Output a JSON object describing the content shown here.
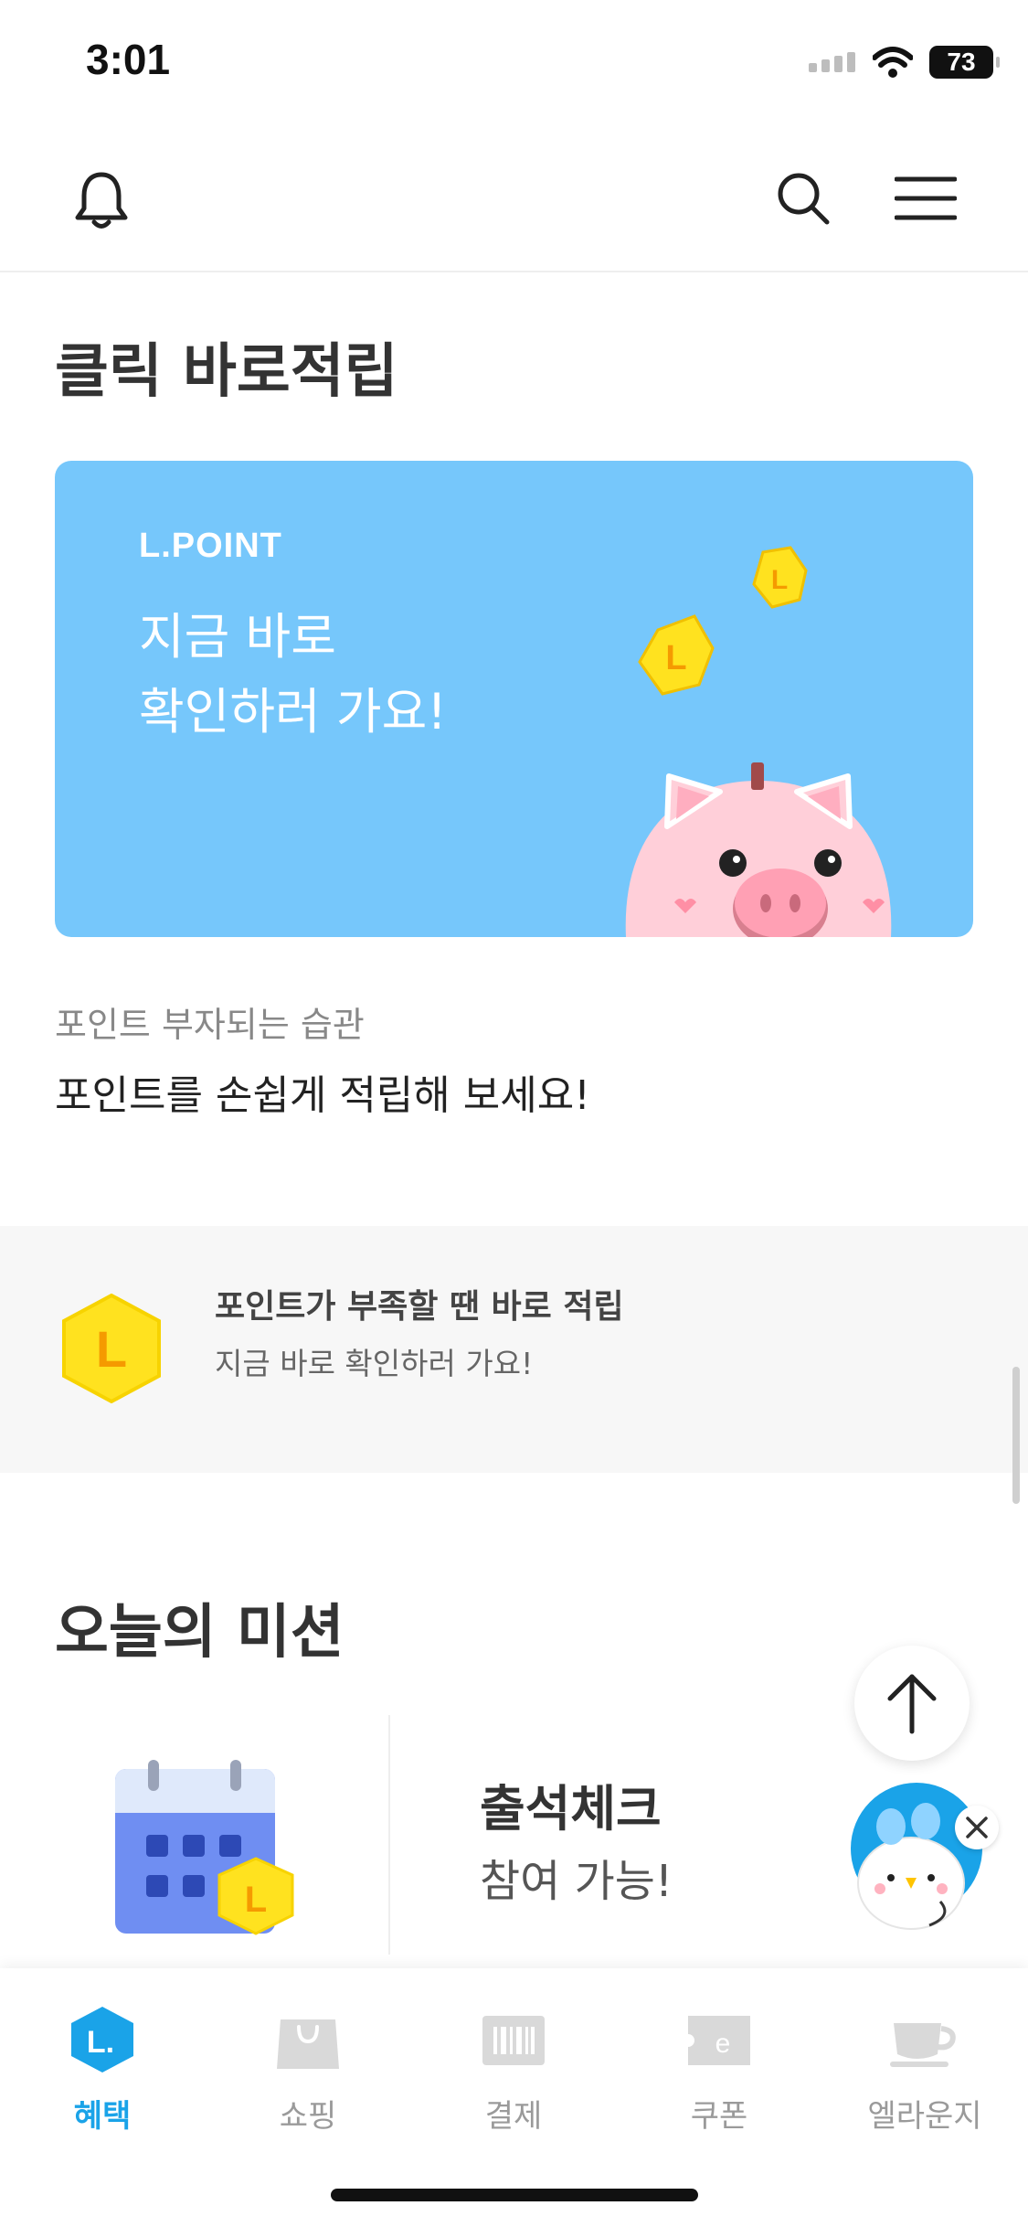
{
  "status_bar": {
    "time": "3:01",
    "battery": "73"
  },
  "header": {
    "icons": [
      "bell-icon",
      "search-icon",
      "menu-icon"
    ]
  },
  "click_section": {
    "title": "클릭 바로적립",
    "banner": {
      "brand": "L.POINT",
      "line1": "지금 바로",
      "line2": "확인하러 가요!"
    },
    "caption_sub": "포인트 부자되는 습관",
    "caption_main": "포인트를 손쉽게 적립해 보세요!"
  },
  "strip": {
    "title": "포인트가 부족할 땐 바로 적립",
    "subtitle": "지금 바로 확인하러 가요!"
  },
  "mission": {
    "title": "오늘의 미션",
    "card_title": "출석체크",
    "card_subtitle": "참여 가능!"
  },
  "bottom_nav": {
    "items": [
      {
        "label": "혜택",
        "icon": "l-point-icon",
        "active": true
      },
      {
        "label": "쇼핑",
        "icon": "shopping-bag-icon"
      },
      {
        "label": "결제",
        "icon": "barcode-icon"
      },
      {
        "label": "쿠폰",
        "icon": "coupon-icon"
      },
      {
        "label": "엘라운지",
        "icon": "coffee-cup-icon"
      }
    ]
  },
  "colors": {
    "accent": "#1aa3e8",
    "banner_bg": "#76c7fb",
    "coin": "#ffe21f"
  }
}
